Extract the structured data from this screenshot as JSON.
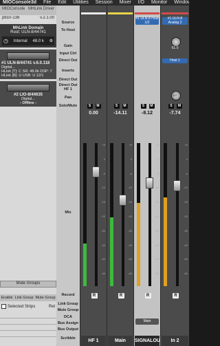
{
  "menubar": {
    "app": "MIOConsole3d",
    "items": [
      "File",
      "Edit",
      "Utilities",
      "Session",
      "Mixer",
      "I/O",
      "Monitor",
      "Window"
    ]
  },
  "left": {
    "tabs": [
      "MIOConsole",
      "MHLink Driver"
    ],
    "session": "pb10-138",
    "version": "v.2.1.00",
    "domain_title": "MhLink Domain",
    "domain_root": "Root: ULN-8/44741",
    "clock_source": "Internal",
    "sample_rate": "48.0 k",
    "unit1_title": "#1 ULN-8/44741 v.6.0.118",
    "unit1_line1": "Digital...",
    "unit1_line2": "HLink [T]: C SR: 48.0k DSP: 7",
    "unit1_line3": "HLink [B]: U USB: U 12/1",
    "unit2_title": "#2 LIO-8/44635",
    "unit2_line1": "Digital...",
    "unit2_status": "- Offline -",
    "mute_groups": "Mute Groups",
    "bottom_tabs": [
      "Enable",
      "Link Group",
      "Mute Group"
    ],
    "selected_strips": "Selected Strips",
    "rel_label": "Rel"
  },
  "labels": {
    "source": "Source",
    "to_host": "To Host",
    "gain": "Gain",
    "input_ctrl": "Input Ctrl",
    "direct_out_1": "Direct Out",
    "inserts": "Inserts",
    "direct_out_2": "Direct Out",
    "direct_out_hf": "Direct Out HF 1",
    "pan": "Pan",
    "solo_mute": "Solo/Mute",
    "mix": "Mix",
    "record": "Record",
    "link_group": "Link Group",
    "mute_group": "Mute Group",
    "dca": "DCA",
    "bus_assign": "Bus Assign",
    "bus_output": "Bus Output",
    "scribble": "Scribble"
  },
  "channels": [
    {
      "name": "HF 1",
      "value": "0.00",
      "solo": "S",
      "mute": "M",
      "rec": "R",
      "meter_level": 0.3,
      "fader_level": 0.8,
      "meter_color": "#3cba3c",
      "accent": "#e8e8e8",
      "style": "dark"
    },
    {
      "name": "Main",
      "value": "-14.11",
      "solo": "S",
      "mute": "M",
      "rec": "R",
      "meter_level": 0.48,
      "fader_level": 0.6,
      "meter_color": "#3cba3c",
      "accent": "#e8d44a",
      "style": "dark"
    },
    {
      "name": "SIGNALOUT",
      "value": "-8.12",
      "solo": "S",
      "mute": "M",
      "rec": "R",
      "meter_level": 0.58,
      "fader_level": 0.72,
      "meter_color": "#e0a020",
      "accent": "#d24a4a",
      "style": "light",
      "source_label": "#1 ULN-8 Host 1/2",
      "bus_label": "Main"
    },
    {
      "name": "In 2",
      "value": "-7.74",
      "solo": "S",
      "mute": "M",
      "rec": "R",
      "meter_level": 0.62,
      "fader_level": 0.7,
      "meter_color": "#e0a020",
      "accent": "#d24a4a",
      "style": "dark",
      "source_label": "#1 ULN-8 Analog 2",
      "knob_value": "61.0",
      "host_label": "Host 1",
      "pan_value": "0.0"
    }
  ],
  "scale_ticks": [
    "+6",
    "0",
    "-5",
    "-10",
    "-15",
    "-20",
    "-30",
    "-40",
    "-50",
    "-60"
  ],
  "colors": {
    "meter_green": "#3cba3c",
    "meter_amber": "#e0a020",
    "route_blue": "#336bb3"
  }
}
